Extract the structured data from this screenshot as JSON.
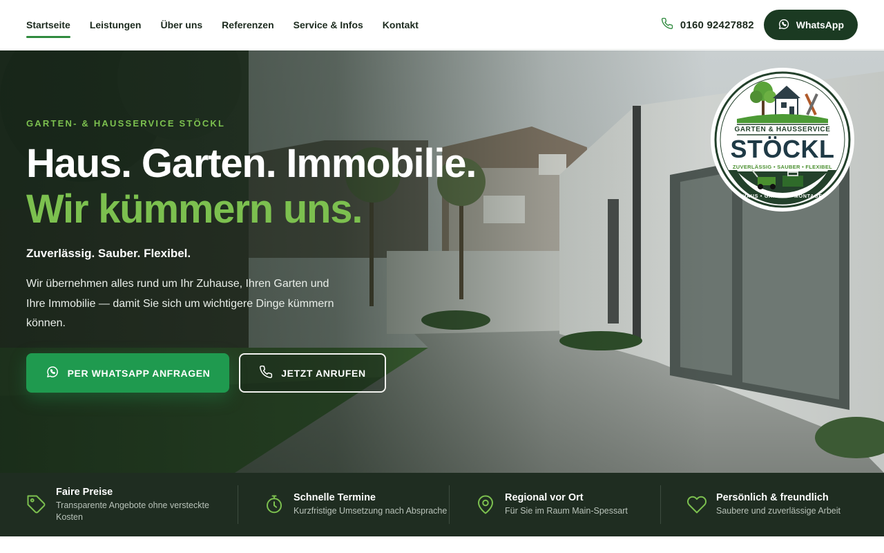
{
  "nav": {
    "items": [
      {
        "label": "Startseite",
        "active": true
      },
      {
        "label": "Leistungen"
      },
      {
        "label": "Über uns"
      },
      {
        "label": "Referenzen"
      },
      {
        "label": "Service & Infos"
      },
      {
        "label": "Kontakt"
      }
    ],
    "phone": "0160 92427882",
    "whatsapp_label": "WhatsApp"
  },
  "hero": {
    "eyebrow": "GARTEN- & HAUSSERVICE STÖCKL",
    "headline_1": "Haus. Garten. Immobilie.",
    "headline_2": "Wir kümmern uns.",
    "tagline": "Zuverlässig. Sauber. Flexibel.",
    "intro": "Wir übernehmen alles rund um Ihr Zuhause, Ihren Garten und Ihre Immobilie — damit Sie sich um wichtigere Dinge kümmern können.",
    "cta_primary": "PER WHATSAPP ANFRAGEN",
    "cta_secondary": "JETZT ANRUFEN"
  },
  "logo": {
    "top_text": "GARTEN & HAUSSERVICE",
    "name": "STÖCKL",
    "claim": "ZUVERLÄSSIG • SAUBER • FLEXIBEL",
    "bottom_text": "HAUS • GARTEN • MONTAGE"
  },
  "features": [
    {
      "icon": "price-tag-icon",
      "title": "Faire Preise",
      "desc": "Transparente Angebote ohne versteckte Kosten"
    },
    {
      "icon": "stopwatch-icon",
      "title": "Schnelle Termine",
      "desc": "Kurzfristige Umsetzung nach Absprache"
    },
    {
      "icon": "location-pin-icon",
      "title": "Regional vor Ort",
      "desc": "Für Sie im Raum Main-Spessart"
    },
    {
      "icon": "heart-icon",
      "title": "Persönlich & freundlich",
      "desc": "Saubere und zuverlässige Arbeit"
    }
  ],
  "colors": {
    "accent_green": "#7cc04f",
    "cta_green": "#1f9a4f",
    "dark_green": "#1b3a22",
    "feature_bar": "#1f2d21"
  }
}
